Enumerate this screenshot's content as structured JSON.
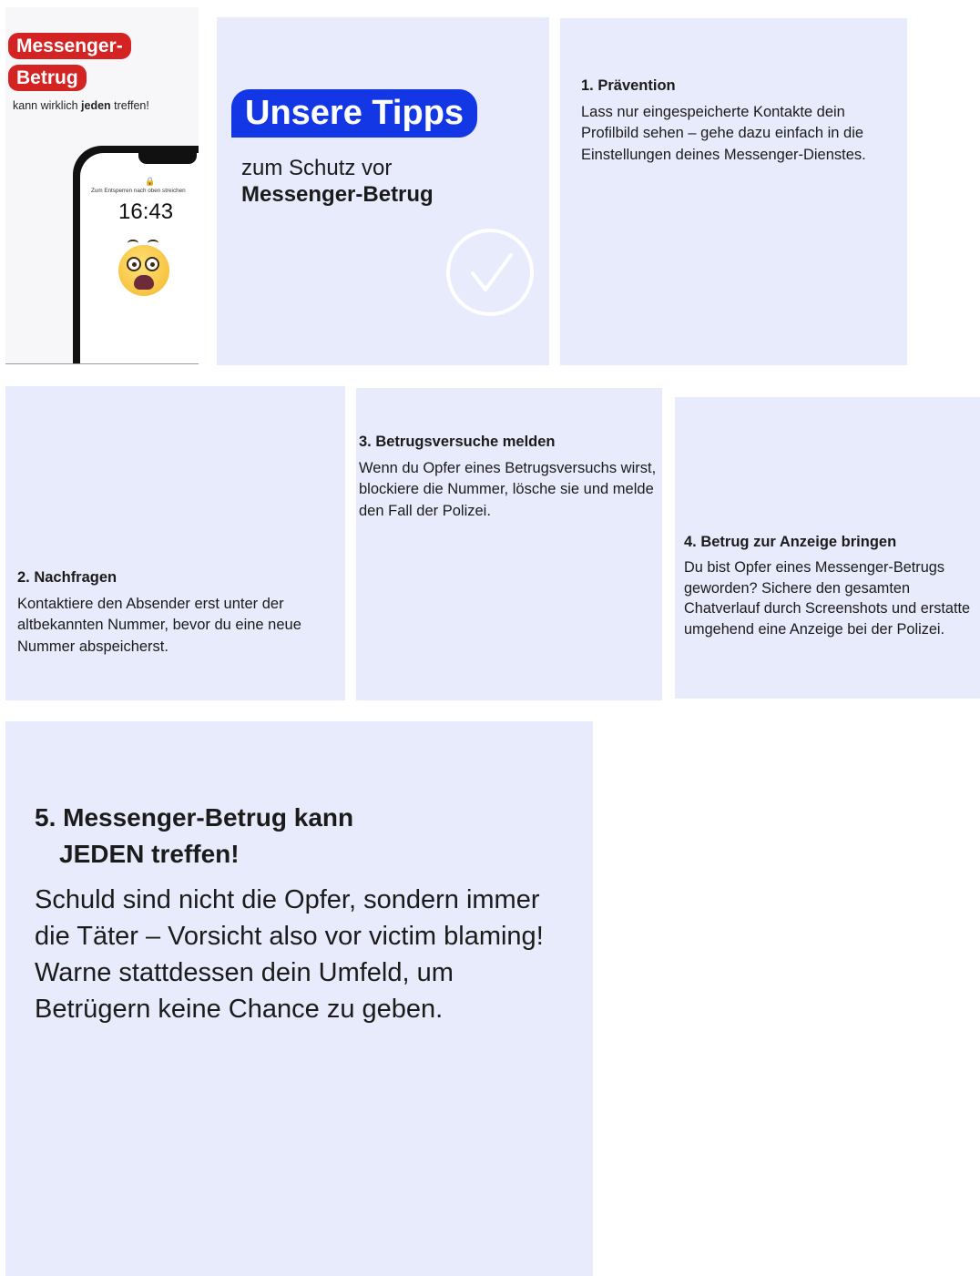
{
  "cover": {
    "badge_line1": "Messenger-",
    "badge_line2": "Betrug",
    "subtitle_before": "kann wirklich ",
    "subtitle_bold": "jeden",
    "subtitle_after": " treffen!",
    "phone_hint": "Zum Entsperren nach oben streichen",
    "phone_time": "16:43",
    "emoji": "face-screaming-in-fear-icon"
  },
  "intro": {
    "title": "Unsere Tipps",
    "subtitle_line1": "zum Schutz vor",
    "subtitle_line2": "Messenger-Betrug",
    "accent_color": "#1437e6"
  },
  "tips": [
    {
      "title": "1. Prävention",
      "text": "Lass nur eingespeicherte Kontakte dein Profilbild sehen – gehe dazu einfach in die Einstellungen deines Messenger-Dienstes."
    },
    {
      "title": "2. Nachfragen",
      "text": "Kontaktiere den Absender erst unter der altbekannten Nummer, bevor du eine neue Nummer abspeicherst."
    },
    {
      "title": "3. Betrugsversuche melden",
      "text": "Wenn du Opfer eines Betrugsversuchs wirst, blockiere die Nummer, lösche sie und melde den Fall der Polizei."
    },
    {
      "title": "4. Betrug zur Anzeige bringen",
      "text": "Du bist Opfer eines Messenger-Betrugs geworden? Sichere den gesamten Chatverlauf durch Screenshots und erstatte umgehend eine Anzeige bei der Polizei."
    },
    {
      "title_line1": "5. Messenger-Betrug kann",
      "title_line2": "JEDEN treffen!",
      "text": "Schuld sind nicht die Opfer, sondern immer die Täter – Vorsicht also vor victim blaming! Warne stattdessen dein Umfeld, um Betrügern keine Chance zu geben."
    }
  ],
  "colors": {
    "card_background": "#e8ebfb",
    "badge_red": "#d42323"
  }
}
